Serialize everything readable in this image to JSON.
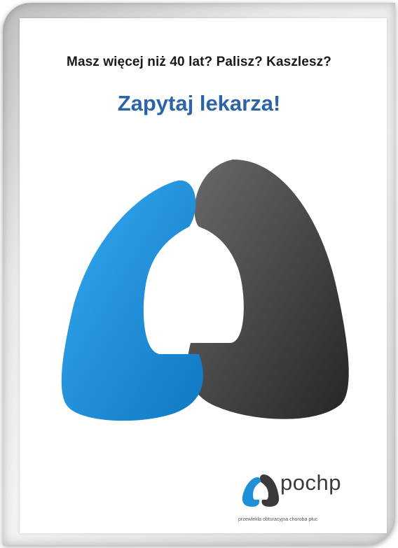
{
  "poster": {
    "question": "Masz więcej niż 40 lat?  Palisz?  Kaszlesz?",
    "headline": "Zapytaj lekarza!"
  },
  "logo": {
    "name": "pochp",
    "tagline": "przewlekła obturacyjna choroba płuc"
  },
  "colors": {
    "blue": "#2c64a8",
    "lung_blue": "#1f8fd8",
    "lung_gray": "#3a3a3a"
  }
}
